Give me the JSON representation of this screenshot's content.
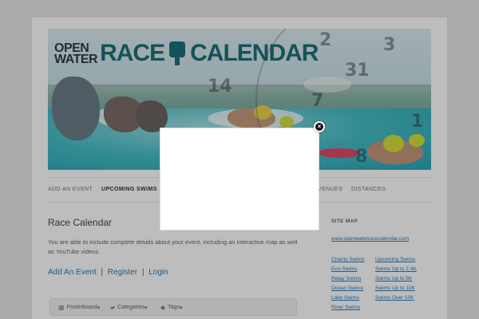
{
  "header": {
    "logo_open": "OPEN",
    "logo_water": "WATER",
    "logo_race": "RACE",
    "logo_calendar": "CALENDAR",
    "calendar_numbers": [
      "2",
      "3",
      "31",
      "7",
      "14",
      "1",
      "8"
    ]
  },
  "nav": {
    "items": [
      {
        "label": "ADD AN EVENT"
      },
      {
        "label": "UPCOMING SWIMS"
      },
      {
        "label": "VENUES"
      },
      {
        "label": "DISTANCES"
      }
    ]
  },
  "main": {
    "title": "Race Calendar",
    "description": "You are able to include complete details about your event, including an interactive map as well as YouTube videos.",
    "links": {
      "add_event": "Add An Event",
      "register": "Register",
      "login": "Login",
      "separator": "|"
    },
    "toolbar": {
      "view": "Posterboard",
      "categories": "Categories",
      "tags": "Tags",
      "caret": "▾"
    }
  },
  "sidebar": {
    "heading": "SITE MAP",
    "url": "www.openwaterracecalendar.com",
    "col1": [
      "Charity Swims",
      "Eco-Swims",
      "Relay Swims",
      "Ocean Swims",
      "Lake Swims",
      "River Swims"
    ],
    "col2": [
      "Upcoming Swims",
      "Swims Up to 2.4K",
      "Swims Up to 5K",
      "Swims Up to 10K",
      "Swims Over 10K"
    ]
  },
  "modal": {
    "close_symbol": "×"
  },
  "colors": {
    "link": "#2b7bb9",
    "overlay": "rgba(0,0,0,0.26)",
    "logo_accent": "#1d6f78"
  },
  "icons": {
    "close": "close-icon",
    "view": "grid-icon",
    "categories": "folder-icon",
    "tags": "tag-icon"
  }
}
